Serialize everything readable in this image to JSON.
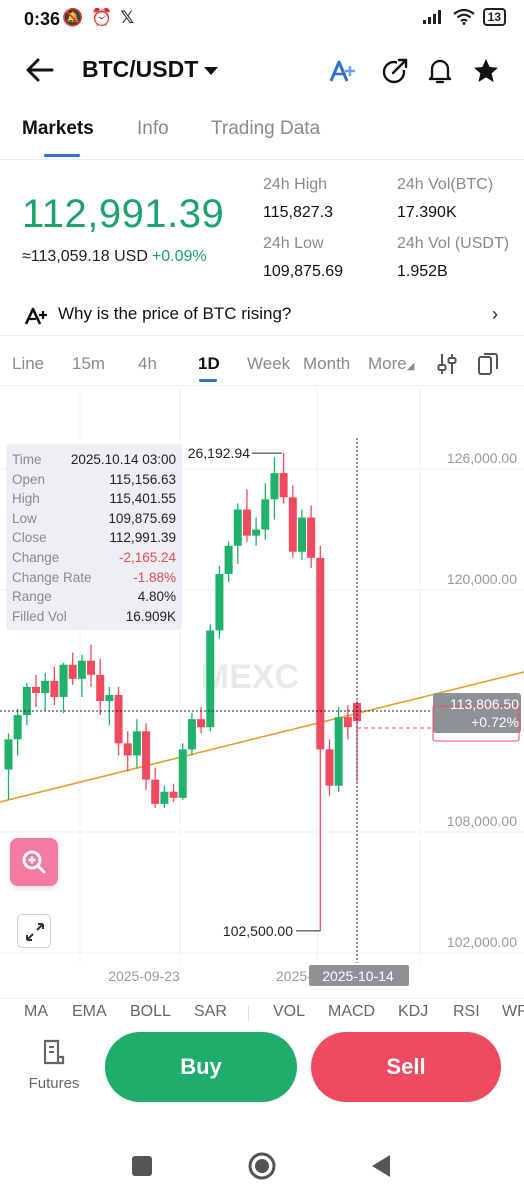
{
  "status_bar": {
    "time": "0:36",
    "battery": "13"
  },
  "header": {
    "pair": "BTC/USDT"
  },
  "tabs": [
    "Markets",
    "Info",
    "Trading Data"
  ],
  "ticker": {
    "last_price": "112,991.39",
    "usd_value": "≈113,059.18 USD",
    "change_pct": "+0.09%",
    "high_24h_label": "24h High",
    "high_24h": "115,827.3",
    "low_24h_label": "24h Low",
    "low_24h": "109,875.69",
    "vol_btc_label": "24h Vol(BTC)",
    "vol_btc": "17.390K",
    "vol_usdt_label": "24h Vol (USDT)",
    "vol_usdt": "1.952B"
  },
  "insight": {
    "text": "Why is the price of BTC rising?"
  },
  "intervals": [
    "Line",
    "15m",
    "4h",
    "1D",
    "Week",
    "Month",
    "More"
  ],
  "tooltip": [
    {
      "k": "Time",
      "v": "2025.10.14 03:00"
    },
    {
      "k": "Open",
      "v": "115,156.63"
    },
    {
      "k": "High",
      "v": "115,401.55"
    },
    {
      "k": "Low",
      "v": "109,875.69"
    },
    {
      "k": "Close",
      "v": "112,991.39"
    },
    {
      "k": "Change",
      "v": "-2,165.24"
    },
    {
      "k": "Change Rate",
      "v": "-1.88%"
    },
    {
      "k": "Range",
      "v": "4.80%"
    },
    {
      "k": "Filled Vol",
      "v": "16.909K"
    }
  ],
  "chart_data": {
    "type": "candlestick",
    "y_ticks": [
      "126,000.00",
      "120,000.00",
      "108,000.00",
      "102,000.00"
    ],
    "x_ticks": [
      "2025-09-23",
      "2025-10-14"
    ],
    "max_label": "26,192.94",
    "min_label": "102,500.00",
    "current_price_label": "113,806.50",
    "current_change_label": "+0.72%",
    "watermark": "MEXC",
    "colors": {
      "up": "#20b26c",
      "down": "#ef4b60",
      "trendline": "#e3a02a"
    },
    "ylim": [
      102000,
      126000
    ],
    "candles": [
      {
        "o": 110500,
        "h": 112300,
        "l": 109000,
        "c": 112000
      },
      {
        "o": 112000,
        "h": 113500,
        "l": 111200,
        "c": 113200
      },
      {
        "o": 113200,
        "h": 114800,
        "l": 112700,
        "c": 114600
      },
      {
        "o": 114600,
        "h": 115200,
        "l": 113600,
        "c": 114300
      },
      {
        "o": 114300,
        "h": 115300,
        "l": 113400,
        "c": 114900
      },
      {
        "o": 114900,
        "h": 115600,
        "l": 113700,
        "c": 114100
      },
      {
        "o": 114100,
        "h": 115800,
        "l": 113300,
        "c": 115700
      },
      {
        "o": 115700,
        "h": 116300,
        "l": 114700,
        "c": 115000
      },
      {
        "o": 115000,
        "h": 116200,
        "l": 114100,
        "c": 115900
      },
      {
        "o": 115900,
        "h": 116700,
        "l": 114600,
        "c": 115200
      },
      {
        "o": 115200,
        "h": 116000,
        "l": 113200,
        "c": 113900
      },
      {
        "o": 113900,
        "h": 114600,
        "l": 112700,
        "c": 114200
      },
      {
        "o": 114200,
        "h": 114600,
        "l": 111200,
        "c": 111800
      },
      {
        "o": 111800,
        "h": 112400,
        "l": 110400,
        "c": 111200
      },
      {
        "o": 111200,
        "h": 113000,
        "l": 110600,
        "c": 112400
      },
      {
        "o": 112400,
        "h": 112800,
        "l": 109500,
        "c": 110000
      },
      {
        "o": 110000,
        "h": 110600,
        "l": 108600,
        "c": 108800
      },
      {
        "o": 108800,
        "h": 109700,
        "l": 108600,
        "c": 109400
      },
      {
        "o": 109400,
        "h": 109800,
        "l": 108900,
        "c": 109100
      },
      {
        "o": 109100,
        "h": 111800,
        "l": 109000,
        "c": 111500
      },
      {
        "o": 111500,
        "h": 113300,
        "l": 111200,
        "c": 113000
      },
      {
        "o": 113000,
        "h": 113600,
        "l": 112300,
        "c": 112600
      },
      {
        "o": 112600,
        "h": 117700,
        "l": 112400,
        "c": 117400
      },
      {
        "o": 117400,
        "h": 120600,
        "l": 117000,
        "c": 120200
      },
      {
        "o": 120200,
        "h": 121800,
        "l": 119800,
        "c": 121600
      },
      {
        "o": 121600,
        "h": 123700,
        "l": 120700,
        "c": 123400
      },
      {
        "o": 123400,
        "h": 124400,
        "l": 121800,
        "c": 122100
      },
      {
        "o": 122100,
        "h": 123000,
        "l": 121600,
        "c": 122400
      },
      {
        "o": 122400,
        "h": 124700,
        "l": 121900,
        "c": 123900
      },
      {
        "o": 123900,
        "h": 126000,
        "l": 122900,
        "c": 125200
      },
      {
        "o": 125200,
        "h": 126193,
        "l": 123700,
        "c": 124000
      },
      {
        "o": 124000,
        "h": 124600,
        "l": 121000,
        "c": 121300
      },
      {
        "o": 121300,
        "h": 123400,
        "l": 120900,
        "c": 123000
      },
      {
        "o": 123000,
        "h": 123600,
        "l": 120500,
        "c": 121000
      },
      {
        "o": 121000,
        "h": 121600,
        "l": 102500,
        "c": 111500
      },
      {
        "o": 111500,
        "h": 112000,
        "l": 109200,
        "c": 109700
      },
      {
        "o": 109700,
        "h": 113600,
        "l": 109400,
        "c": 113100
      },
      {
        "o": 113100,
        "h": 113700,
        "l": 112000,
        "c": 112600
      },
      {
        "o": 113800,
        "h": 113900,
        "l": 109900,
        "c": 112900
      }
    ]
  },
  "indicators": [
    "MA",
    "EMA",
    "BOLL",
    "SAR",
    "VOL",
    "MACD",
    "KDJ",
    "RSI",
    "WR"
  ],
  "actions": {
    "futures": "Futures",
    "buy": "Buy",
    "sell": "Sell"
  }
}
